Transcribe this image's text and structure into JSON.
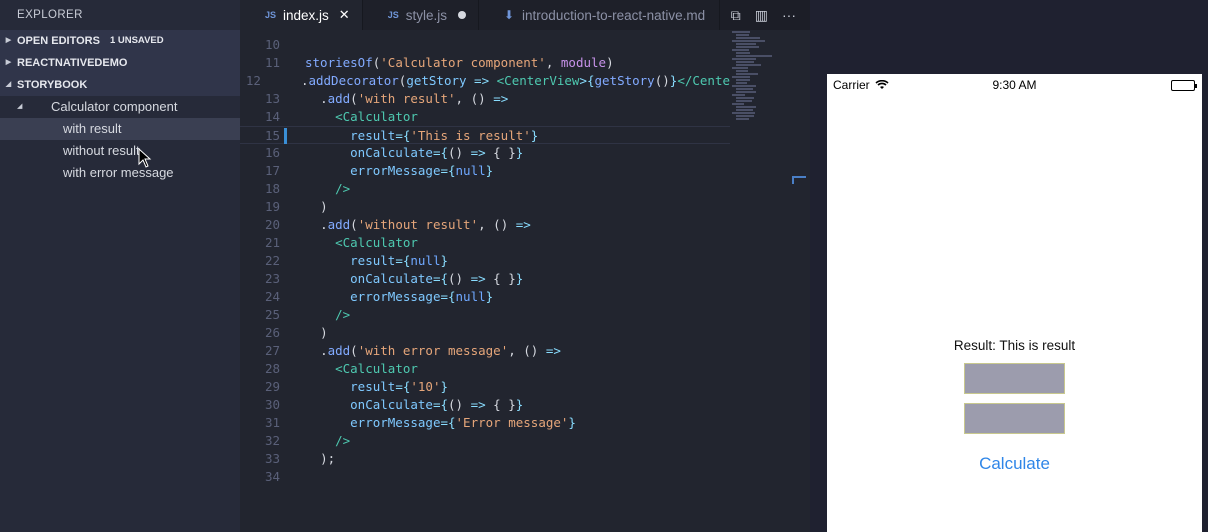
{
  "sidebar": {
    "title": "EXPLORER",
    "sections": {
      "open_editors": "OPEN EDITORS",
      "unsaved_badge": "1 UNSAVED",
      "project": "REACTNATIVEDEMO",
      "storybook": "STORYBOOK"
    },
    "tree": {
      "parent": "Calculator component",
      "items": [
        "with result",
        "without result",
        "with error message"
      ]
    }
  },
  "tabs": [
    {
      "label": "index.js",
      "icon": "js-icon",
      "badge": "JS"
    },
    {
      "label": "style.js",
      "icon": "js-icon",
      "badge": "JS"
    },
    {
      "label": "introduction-to-react-native.md",
      "icon": "markdown-icon"
    }
  ],
  "code": {
    "line_numbers": [
      "10",
      "11",
      "12",
      "13",
      "14",
      "15",
      "16",
      "17",
      "18",
      "19",
      "20",
      "21",
      "22",
      "23",
      "24",
      "25",
      "26",
      "27",
      "28",
      "29",
      "30",
      "31",
      "32",
      "33",
      "34"
    ],
    "current_line": "15"
  },
  "simulator": {
    "carrier": "Carrier",
    "time": "9:30 AM",
    "result_text": "Result: This is result",
    "calculate_label": "Calculate"
  },
  "colors": {
    "accent": "#2f86e8",
    "sidebar_bg": "#262a39",
    "editor_bg": "#22252f"
  }
}
